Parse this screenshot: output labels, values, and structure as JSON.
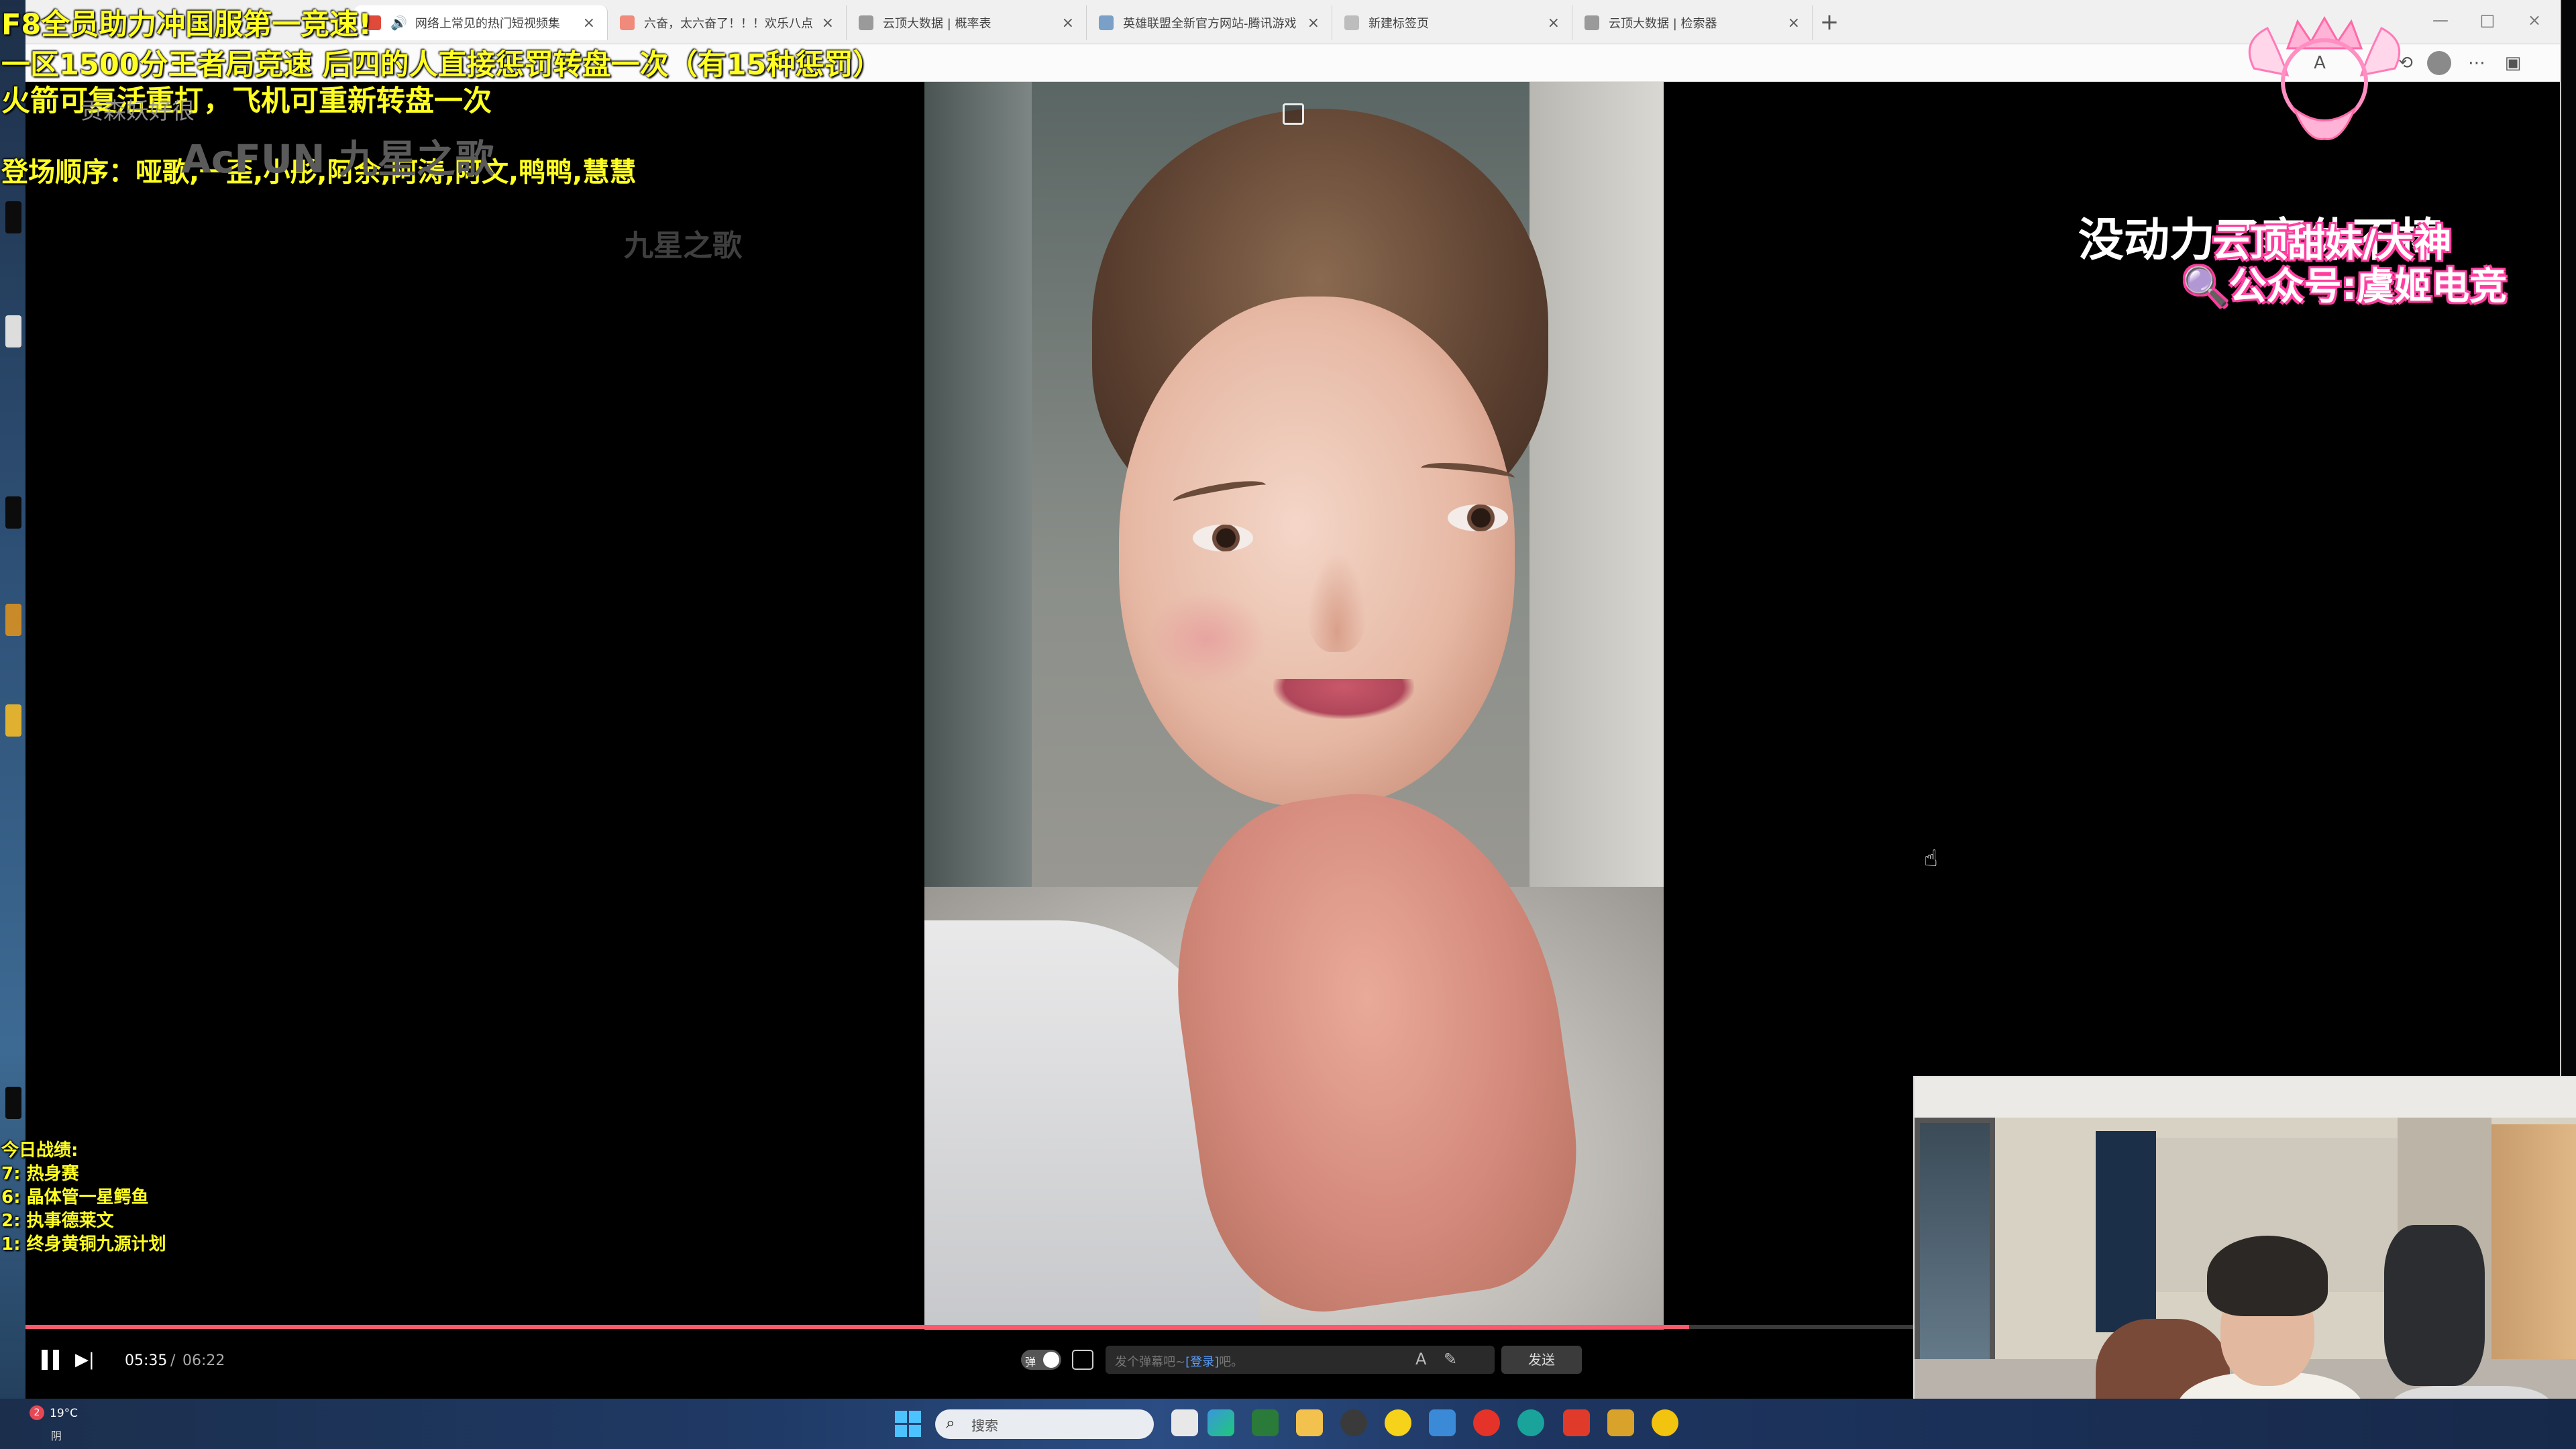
{
  "browser": {
    "tabs": [
      {
        "label": "网络上常见的热门短视频集",
        "favicon_color": "#e04a3a",
        "muted_icon": "speaker-icon"
      },
      {
        "label": "六奋，太六奋了！！！欢乐八点",
        "favicon_color": "#f08a7a"
      },
      {
        "label": "云顶大数据 | 概率表",
        "favicon_color": "#9a9a9a"
      },
      {
        "label": "英雄联盟全新官方网站-腾讯游戏",
        "favicon_color": "#7aa0c8"
      },
      {
        "label": "新建标签页",
        "favicon_color": "#bdbdbd"
      },
      {
        "label": "云顶大数据 | 检索器",
        "favicon_color": "#9a9a9a"
      }
    ],
    "tab_close": "×",
    "new_tab": "+",
    "window_controls": [
      "—",
      "□",
      "×"
    ],
    "profile_badge": "A"
  },
  "overlay": {
    "line1": "F8全员助力冲国服第一竞速!",
    "line2": "一区1500分王者局竞速 后四的人直接惩罚转盘一次（有15种惩罚）",
    "line3": "火箭可复活重打，飞机可重新转盘一次",
    "line4": "登场顺序：哑歌,一歪,小彤,阿余,阿涛,阿文,鸭鸭,慧慧",
    "brand_faint": "贡森妖好很",
    "acfun": "AcFUN 九星之歌",
    "song_faint": "九星之歌",
    "right_white": "没动力了家休不棒",
    "right_pink1": "云顶甜妹/大神",
    "right_pink2": "🔍公众号:虞姬电竞",
    "record_title": "今日战绩:",
    "records": [
      {
        "rank": "7:",
        "name": "热身赛"
      },
      {
        "rank": "6:",
        "name": "晶体管一星鳄鱼"
      },
      {
        "rank": "2:",
        "name": "执事德莱文"
      },
      {
        "rank": "1:",
        "name": "终身黄铜九源计划"
      }
    ]
  },
  "player": {
    "progress": 0.88,
    "current_time": "05:35",
    "separator": "/",
    "total_time": "06:22",
    "danmaku_toggle_label": "弹",
    "danmaku_placeholder_pre": "发个弹幕吧~",
    "danmaku_placeholder_link": "[登录]",
    "danmaku_placeholder_post": "吧。",
    "send_label": "发送"
  },
  "taskbar": {
    "weather_temp": "19°C",
    "weather_desc": "阴",
    "notif_count": "2",
    "search_placeholder": "搜索"
  },
  "colors": {
    "overlay_text": "#ffff22",
    "pink_outline": "#ff3fa0",
    "progress": "#fb5a6e"
  }
}
